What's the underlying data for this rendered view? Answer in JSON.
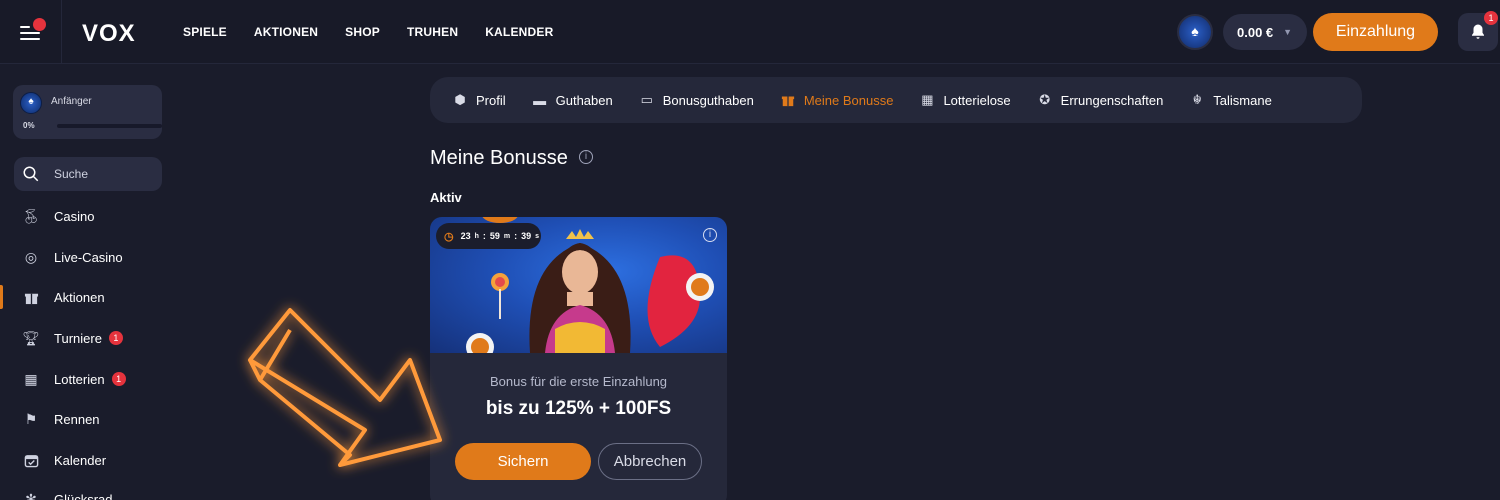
{
  "header": {
    "logo": "VOX",
    "nav": [
      "SPIELE",
      "AKTIONEN",
      "SHOP",
      "TRUHEN",
      "KALENDER"
    ],
    "balance": "0.00 €",
    "deposit_label": "Einzahlung",
    "notifications_count": "1"
  },
  "sidebar": {
    "rank": {
      "name": "Anfänger",
      "progress_label": "0%",
      "progress": 0
    },
    "search_placeholder": "Suche",
    "items": [
      {
        "label": "Casino",
        "icon": "cherry-icon",
        "badge": ""
      },
      {
        "label": "Live-Casino",
        "icon": "chip-icon",
        "badge": ""
      },
      {
        "label": "Aktionen",
        "icon": "gift-icon",
        "badge": ""
      },
      {
        "label": "Turniere",
        "icon": "trophy-icon",
        "badge": "1"
      },
      {
        "label": "Lotterien",
        "icon": "lottery-icon",
        "badge": "1"
      },
      {
        "label": "Rennen",
        "icon": "checkered-flag-icon",
        "badge": ""
      },
      {
        "label": "Kalender",
        "icon": "calendar-icon",
        "badge": ""
      },
      {
        "label": "Glücksrad",
        "icon": "wheel-icon",
        "badge": ""
      }
    ]
  },
  "tabs": [
    {
      "label": "Profil",
      "icon": "profile-icon"
    },
    {
      "label": "Guthaben",
      "icon": "wallet-icon"
    },
    {
      "label": "Bonusguthaben",
      "icon": "bonus-wallet-icon"
    },
    {
      "label": "Meine Bonusse",
      "icon": "gift-icon"
    },
    {
      "label": "Lotterielose",
      "icon": "ticket-icon"
    },
    {
      "label": "Errungenschaften",
      "icon": "medal-icon"
    },
    {
      "label": "Talismane",
      "icon": "talisman-icon"
    }
  ],
  "main": {
    "title": "Meine Bonusse",
    "section": "Aktiv",
    "bonus": {
      "timer": {
        "h": "23",
        "h_unit": "h",
        "m": "59",
        "m_unit": "m",
        "s": "39",
        "s_unit": "s"
      },
      "subtitle": "Bonus für die erste Einzahlung",
      "offer": "bis zu 125% + 100FS",
      "claim_label": "Sichern",
      "cancel_label": "Abbrechen"
    }
  },
  "colors": {
    "accent": "#e07a1a",
    "background": "#1a1c2b",
    "panel": "#25283a",
    "badge": "#e5333d"
  }
}
